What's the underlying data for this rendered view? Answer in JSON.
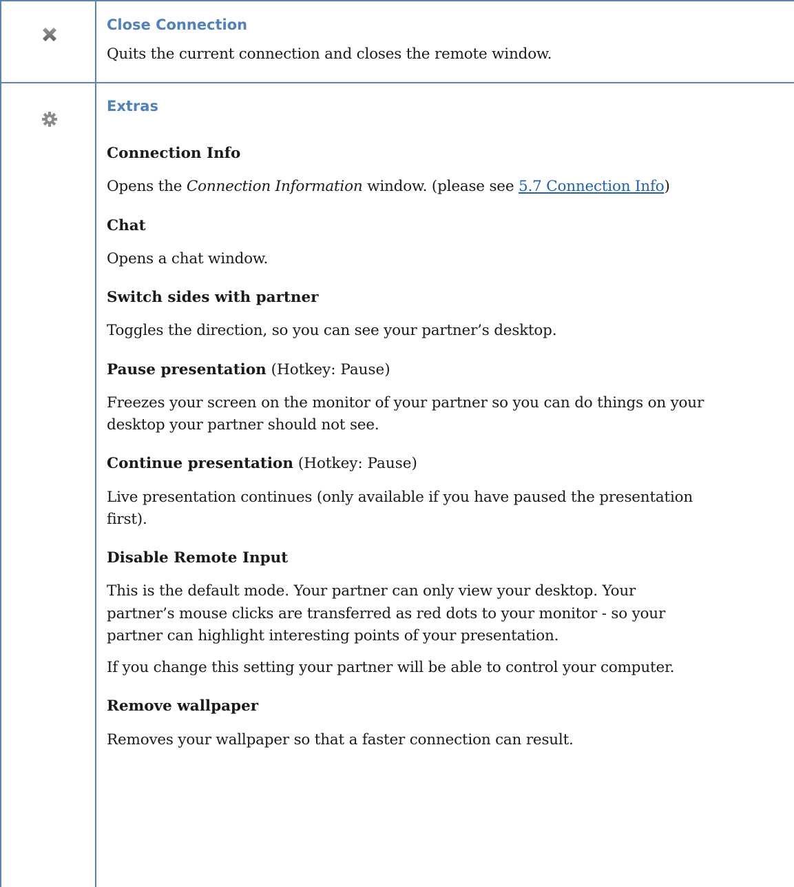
{
  "close": {
    "heading": "Close Connection",
    "description": "Quits the current connection and closes the remote window."
  },
  "extras": {
    "heading": "Extras",
    "connection_info": {
      "title": "Connection Info",
      "text_before": "Opens the ",
      "text_em": "Connection Information",
      "text_middle": " window. (please see ",
      "link": "5.7 Connection Info",
      "text_after": ")"
    },
    "chat": {
      "title": "Chat",
      "text": "Opens a chat window."
    },
    "switch_sides": {
      "title": "Switch sides with partner",
      "text": "Toggles the direction, so you can see your partner’s desktop."
    },
    "pause": {
      "title": "Pause presentation",
      "hotkey": " (Hotkey: Pause)",
      "text_line1": "Freezes your screen on the monitor of your partner so you can do things on your",
      "text_line2": "desktop your partner should not see."
    },
    "continue": {
      "title": "Continue presentation",
      "hotkey": " (Hotkey: Pause)",
      "text_line1": "Live presentation continues (only available if you have paused the presentation",
      "text_line2": "first)."
    },
    "disable_input": {
      "title": "Disable Remote Input",
      "text_line1": "This is the default mode. Your partner can only view your desktop. Your",
      "text_line2": "partner’s mouse clicks are transferred as red dots to your monitor - so your",
      "text_line3": "partner can highlight interesting points of your presentation.",
      "text2": "If you change this setting your partner will be able to control your computer."
    },
    "wallpaper": {
      "title": "Remove wallpaper",
      "text": "Removes your wallpaper so that a faster connection can result."
    }
  },
  "icons": {
    "close": "close-icon",
    "extras": "gear-icon"
  },
  "colors": {
    "border": "#5b84b1",
    "heading": "#4f81bd",
    "link": "#1f5fbf"
  }
}
